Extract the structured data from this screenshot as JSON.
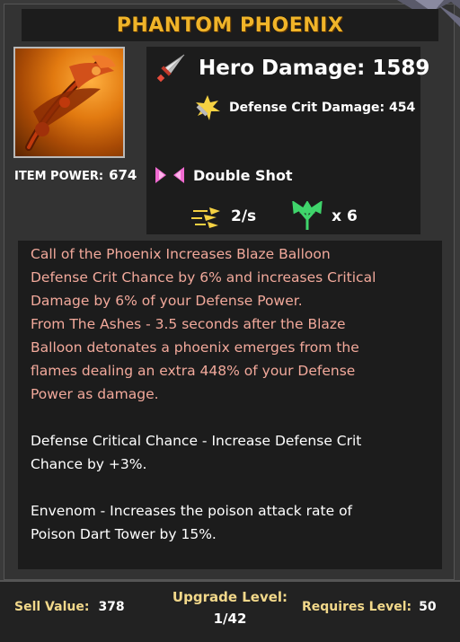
{
  "item": {
    "name": "PHANTOM PHOENIX",
    "power_label": "ITEM POWER:",
    "power_value": "674",
    "image_icon": "phoenix-bow-icon"
  },
  "stats": {
    "hero_damage_label": "Hero Damage:",
    "hero_damage_value": "1589",
    "hero_damage_icon": "sword-icon",
    "crit_label": "Defense Crit Damage:",
    "crit_value": "454",
    "crit_icon": "crit-burst-icon",
    "skill_name": "Double Shot",
    "skill_icon": "double-shot-icon",
    "attack_rate": "2/s",
    "attack_rate_icon": "speed-icon",
    "projectiles": "x 6",
    "projectiles_icon": "multi-arrow-icon"
  },
  "description": {
    "pink_lines": [
      "Call of the Phoenix  Increases Blaze Balloon",
      "Defense Crit Chance by 6% and increases Critical",
      "Damage by 6% of your Defense Power.",
      "From The Ashes - 3.5 seconds after the Blaze",
      "Balloon detonates a phoenix emerges from the",
      "flames dealing an extra 448% of your Defense",
      "Power as damage."
    ],
    "bonus1_lines": [
      "Defense Critical Chance - Increase Defense Crit",
      "Chance by +3%."
    ],
    "bonus2_lines": [
      "Envenom - Increases the poison attack rate of",
      "Poison Dart Tower by 15%."
    ]
  },
  "footer": {
    "sell_label": "Sell Value:",
    "sell_value": "378",
    "upgrade_label": "Upgrade Level:",
    "upgrade_value": "1/42",
    "requires_label": "Requires Level:",
    "requires_value": "50"
  },
  "colors": {
    "title": "#f0b429",
    "description_special": "#f2a99b",
    "footer_label": "#f2d88a",
    "panel": "#1c1c1c",
    "background": "#333333"
  }
}
